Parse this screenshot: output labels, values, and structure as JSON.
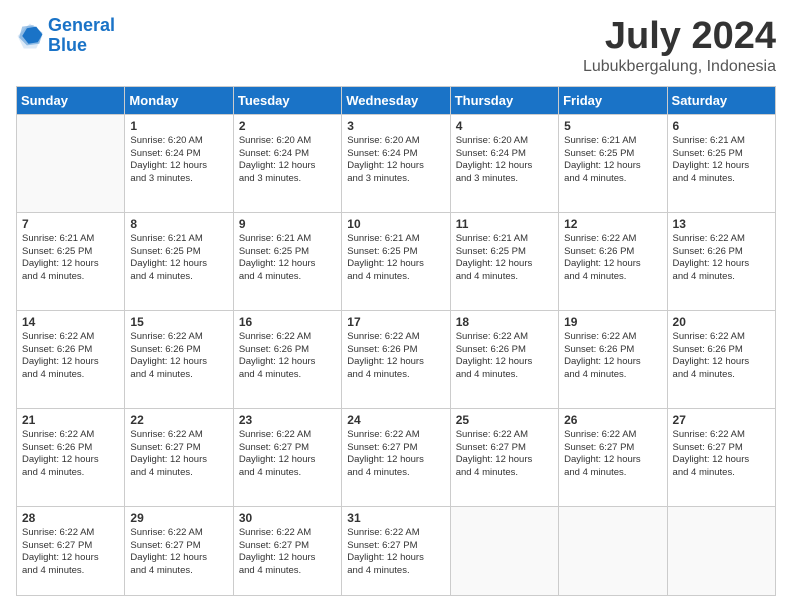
{
  "header": {
    "logo_line1": "General",
    "logo_line2": "Blue",
    "month": "July 2024",
    "location": "Lubukbergalung, Indonesia"
  },
  "weekdays": [
    "Sunday",
    "Monday",
    "Tuesday",
    "Wednesday",
    "Thursday",
    "Friday",
    "Saturday"
  ],
  "weeks": [
    [
      {
        "day": "",
        "info": ""
      },
      {
        "day": "1",
        "info": "Sunrise: 6:20 AM\nSunset: 6:24 PM\nDaylight: 12 hours\nand 3 minutes."
      },
      {
        "day": "2",
        "info": "Sunrise: 6:20 AM\nSunset: 6:24 PM\nDaylight: 12 hours\nand 3 minutes."
      },
      {
        "day": "3",
        "info": "Sunrise: 6:20 AM\nSunset: 6:24 PM\nDaylight: 12 hours\nand 3 minutes."
      },
      {
        "day": "4",
        "info": "Sunrise: 6:20 AM\nSunset: 6:24 PM\nDaylight: 12 hours\nand 3 minutes."
      },
      {
        "day": "5",
        "info": "Sunrise: 6:21 AM\nSunset: 6:25 PM\nDaylight: 12 hours\nand 4 minutes."
      },
      {
        "day": "6",
        "info": "Sunrise: 6:21 AM\nSunset: 6:25 PM\nDaylight: 12 hours\nand 4 minutes."
      }
    ],
    [
      {
        "day": "7",
        "info": "Sunrise: 6:21 AM\nSunset: 6:25 PM\nDaylight: 12 hours\nand 4 minutes."
      },
      {
        "day": "8",
        "info": "Sunrise: 6:21 AM\nSunset: 6:25 PM\nDaylight: 12 hours\nand 4 minutes."
      },
      {
        "day": "9",
        "info": "Sunrise: 6:21 AM\nSunset: 6:25 PM\nDaylight: 12 hours\nand 4 minutes."
      },
      {
        "day": "10",
        "info": "Sunrise: 6:21 AM\nSunset: 6:25 PM\nDaylight: 12 hours\nand 4 minutes."
      },
      {
        "day": "11",
        "info": "Sunrise: 6:21 AM\nSunset: 6:25 PM\nDaylight: 12 hours\nand 4 minutes."
      },
      {
        "day": "12",
        "info": "Sunrise: 6:22 AM\nSunset: 6:26 PM\nDaylight: 12 hours\nand 4 minutes."
      },
      {
        "day": "13",
        "info": "Sunrise: 6:22 AM\nSunset: 6:26 PM\nDaylight: 12 hours\nand 4 minutes."
      }
    ],
    [
      {
        "day": "14",
        "info": "Sunrise: 6:22 AM\nSunset: 6:26 PM\nDaylight: 12 hours\nand 4 minutes."
      },
      {
        "day": "15",
        "info": "Sunrise: 6:22 AM\nSunset: 6:26 PM\nDaylight: 12 hours\nand 4 minutes."
      },
      {
        "day": "16",
        "info": "Sunrise: 6:22 AM\nSunset: 6:26 PM\nDaylight: 12 hours\nand 4 minutes."
      },
      {
        "day": "17",
        "info": "Sunrise: 6:22 AM\nSunset: 6:26 PM\nDaylight: 12 hours\nand 4 minutes."
      },
      {
        "day": "18",
        "info": "Sunrise: 6:22 AM\nSunset: 6:26 PM\nDaylight: 12 hours\nand 4 minutes."
      },
      {
        "day": "19",
        "info": "Sunrise: 6:22 AM\nSunset: 6:26 PM\nDaylight: 12 hours\nand 4 minutes."
      },
      {
        "day": "20",
        "info": "Sunrise: 6:22 AM\nSunset: 6:26 PM\nDaylight: 12 hours\nand 4 minutes."
      }
    ],
    [
      {
        "day": "21",
        "info": "Sunrise: 6:22 AM\nSunset: 6:26 PM\nDaylight: 12 hours\nand 4 minutes."
      },
      {
        "day": "22",
        "info": "Sunrise: 6:22 AM\nSunset: 6:27 PM\nDaylight: 12 hours\nand 4 minutes."
      },
      {
        "day": "23",
        "info": "Sunrise: 6:22 AM\nSunset: 6:27 PM\nDaylight: 12 hours\nand 4 minutes."
      },
      {
        "day": "24",
        "info": "Sunrise: 6:22 AM\nSunset: 6:27 PM\nDaylight: 12 hours\nand 4 minutes."
      },
      {
        "day": "25",
        "info": "Sunrise: 6:22 AM\nSunset: 6:27 PM\nDaylight: 12 hours\nand 4 minutes."
      },
      {
        "day": "26",
        "info": "Sunrise: 6:22 AM\nSunset: 6:27 PM\nDaylight: 12 hours\nand 4 minutes."
      },
      {
        "day": "27",
        "info": "Sunrise: 6:22 AM\nSunset: 6:27 PM\nDaylight: 12 hours\nand 4 minutes."
      }
    ],
    [
      {
        "day": "28",
        "info": "Sunrise: 6:22 AM\nSunset: 6:27 PM\nDaylight: 12 hours\nand 4 minutes."
      },
      {
        "day": "29",
        "info": "Sunrise: 6:22 AM\nSunset: 6:27 PM\nDaylight: 12 hours\nand 4 minutes."
      },
      {
        "day": "30",
        "info": "Sunrise: 6:22 AM\nSunset: 6:27 PM\nDaylight: 12 hours\nand 4 minutes."
      },
      {
        "day": "31",
        "info": "Sunrise: 6:22 AM\nSunset: 6:27 PM\nDaylight: 12 hours\nand 4 minutes."
      },
      {
        "day": "",
        "info": ""
      },
      {
        "day": "",
        "info": ""
      },
      {
        "day": "",
        "info": ""
      }
    ]
  ]
}
